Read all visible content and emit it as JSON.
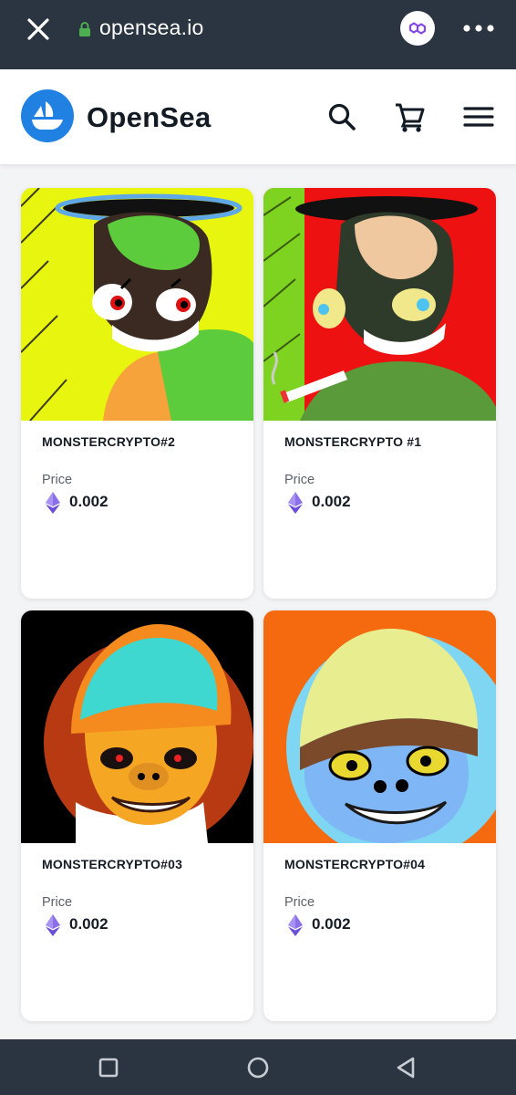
{
  "browser": {
    "url": "opensea.io",
    "icons": [
      "close-icon",
      "lock-icon",
      "polygon-icon",
      "more-icon"
    ]
  },
  "header": {
    "brand": "OpenSea",
    "icons": [
      "opensea-logo",
      "search-icon",
      "cart-icon",
      "menu-icon"
    ]
  },
  "colors": {
    "brand_blue": "#2081e2",
    "topbar": "#2b3541",
    "eth_purple": "#8a6fe8"
  },
  "cards": [
    {
      "name": "MONSTERCRYPTO#2",
      "price_label": "Price",
      "price": "0.002"
    },
    {
      "name": "MONSTERCRYPTO #1",
      "price_label": "Price",
      "price": "0.002"
    },
    {
      "name": "MONSTERCRYPTO#03",
      "price_label": "Price",
      "price": "0.002"
    },
    {
      "name": "MONSTERCRYPTO#04",
      "price_label": "Price",
      "price": "0.002"
    }
  ],
  "nav": {
    "icons": [
      "recent-apps-icon",
      "home-icon",
      "back-icon"
    ]
  }
}
